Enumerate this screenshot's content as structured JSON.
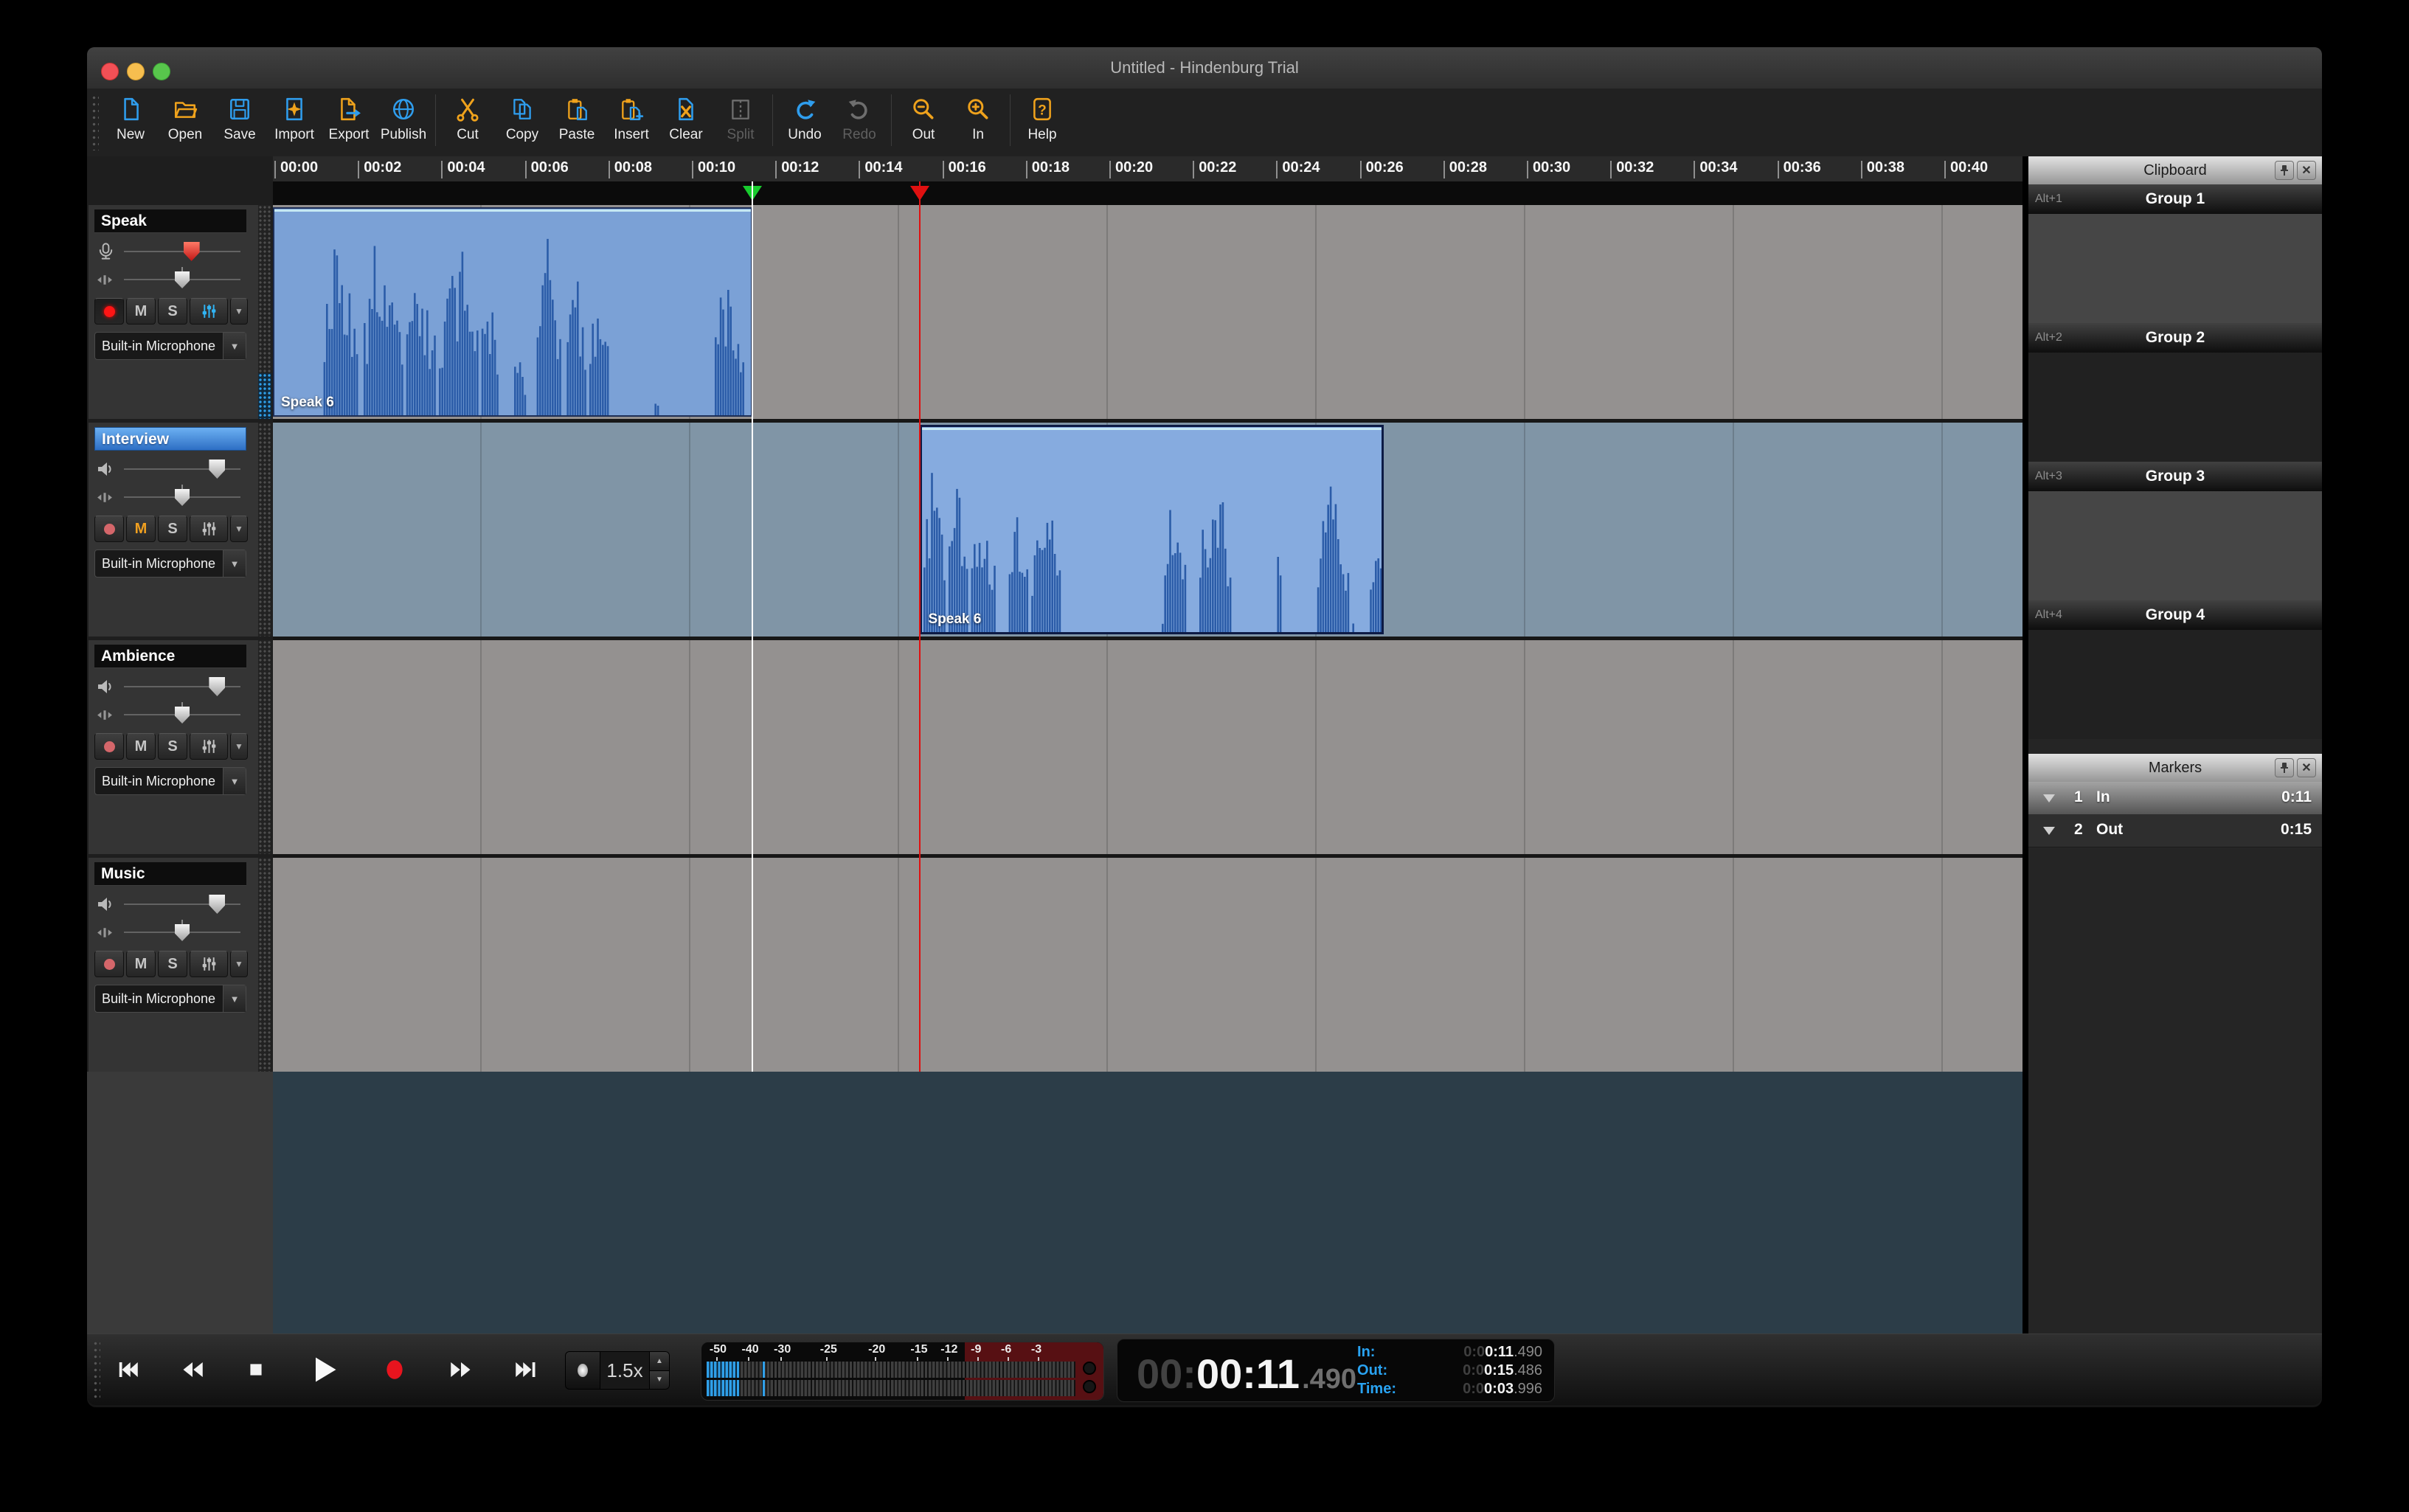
{
  "window": {
    "title": "Untitled - Hindenburg Trial"
  },
  "toolbar": {
    "items": [
      {
        "id": "new",
        "label": "New",
        "enabled": true
      },
      {
        "id": "open",
        "label": "Open",
        "enabled": true
      },
      {
        "id": "save",
        "label": "Save",
        "enabled": true
      },
      {
        "id": "import",
        "label": "Import",
        "enabled": true
      },
      {
        "id": "export",
        "label": "Export",
        "enabled": true
      },
      {
        "id": "publish",
        "label": "Publish",
        "enabled": true
      },
      {
        "id": "sep"
      },
      {
        "id": "cut",
        "label": "Cut",
        "enabled": true
      },
      {
        "id": "copy",
        "label": "Copy",
        "enabled": true
      },
      {
        "id": "paste",
        "label": "Paste",
        "enabled": true
      },
      {
        "id": "insert",
        "label": "Insert",
        "enabled": true
      },
      {
        "id": "clear",
        "label": "Clear",
        "enabled": true
      },
      {
        "id": "split",
        "label": "Split",
        "enabled": false
      },
      {
        "id": "sep"
      },
      {
        "id": "undo",
        "label": "Undo",
        "enabled": true
      },
      {
        "id": "redo",
        "label": "Redo",
        "enabled": false
      },
      {
        "id": "sep"
      },
      {
        "id": "out",
        "label": "Out",
        "enabled": true
      },
      {
        "id": "in",
        "label": "In",
        "enabled": true
      },
      {
        "id": "sep"
      },
      {
        "id": "help",
        "label": "Help",
        "enabled": true
      }
    ]
  },
  "ruler": {
    "labels": [
      "00:00",
      "00:02",
      "00:04",
      "00:06",
      "00:08",
      "00:10",
      "00:12",
      "00:14",
      "00:16",
      "00:18",
      "00:20",
      "00:22",
      "00:24",
      "00:26",
      "00:28",
      "00:30",
      "00:32",
      "00:34",
      "00:36",
      "00:38",
      "00:40"
    ]
  },
  "tracks": [
    {
      "name": "Speak",
      "selected": false,
      "armed": true,
      "muted": false,
      "eq_active": true,
      "volume": 0.58,
      "pan": 0.5,
      "device": "Built-in Microphone",
      "meter_signal": true
    },
    {
      "name": "Interview",
      "selected": true,
      "armed": false,
      "muted": true,
      "eq_active": false,
      "volume": 0.8,
      "pan": 0.5,
      "device": "Built-in Microphone",
      "meter_signal": false
    },
    {
      "name": "Ambience",
      "selected": false,
      "armed": false,
      "muted": false,
      "eq_active": false,
      "volume": 0.8,
      "pan": 0.5,
      "device": "Built-in Microphone",
      "meter_signal": false
    },
    {
      "name": "Music",
      "selected": false,
      "armed": false,
      "muted": false,
      "eq_active": false,
      "volume": 0.8,
      "pan": 0.5,
      "device": "Built-in Microphone",
      "meter_signal": false
    }
  ],
  "clips": [
    {
      "track": 0,
      "label": "Speak 6",
      "start_s": 0.0,
      "end_s": 11.49,
      "selected": false,
      "bursts": [
        [
          0.1,
          0.175,
          1.0
        ],
        [
          0.185,
          0.27,
          0.95
        ],
        [
          0.275,
          0.335,
          0.9
        ],
        [
          0.345,
          0.425,
          0.92
        ],
        [
          0.43,
          0.47,
          0.65
        ],
        [
          0.5,
          0.525,
          0.4
        ],
        [
          0.55,
          0.6,
          0.95
        ],
        [
          0.61,
          0.655,
          0.9
        ],
        [
          0.66,
          0.7,
          0.8
        ],
        [
          0.795,
          0.807,
          0.12
        ],
        [
          0.92,
          0.985,
          0.8
        ]
      ]
    },
    {
      "track": 1,
      "label": "Speak 6",
      "start_s": 15.486,
      "end_s": 26.6,
      "selected": true,
      "bursts": [
        [
          0.0,
          0.05,
          1.0
        ],
        [
          0.055,
          0.1,
          0.85
        ],
        [
          0.105,
          0.16,
          0.72
        ],
        [
          0.185,
          0.23,
          0.8
        ],
        [
          0.235,
          0.3,
          0.72
        ],
        [
          0.52,
          0.57,
          0.88
        ],
        [
          0.6,
          0.67,
          0.9
        ],
        [
          0.765,
          0.778,
          0.55
        ],
        [
          0.855,
          0.925,
          0.82
        ],
        [
          0.97,
          1.0,
          0.55
        ]
      ]
    }
  ],
  "timeline_markers": {
    "in_s": 11.49,
    "out_s": 15.486
  },
  "clipboard": {
    "title": "Clipboard",
    "groups": [
      {
        "shortcut": "Alt+1",
        "label": "Group 1"
      },
      {
        "shortcut": "Alt+2",
        "label": "Group 2"
      },
      {
        "shortcut": "Alt+3",
        "label": "Group 3"
      },
      {
        "shortcut": "Alt+4",
        "label": "Group 4"
      }
    ]
  },
  "markers_panel": {
    "title": "Markers",
    "rows": [
      {
        "num": "1",
        "name": "In",
        "time": "0:11"
      },
      {
        "num": "2",
        "name": "Out",
        "time": "0:15"
      }
    ]
  },
  "transport": {
    "buttons": [
      "skip-start",
      "rewind",
      "stop",
      "play",
      "record",
      "fast-forward",
      "skip-end"
    ],
    "speed": "1.5x",
    "meter": {
      "scale": [
        [
          "-50",
          2
        ],
        [
          "-40",
          10
        ],
        [
          "-30",
          18
        ],
        [
          "-25",
          29.5
        ],
        [
          "-20",
          41.5
        ],
        [
          "-15",
          52
        ],
        [
          "-12",
          59.5
        ],
        [
          "-9",
          67
        ],
        [
          "-6",
          74.5
        ],
        [
          "-3",
          82
        ]
      ],
      "lit_frac": 0.09,
      "isolated_frac": 0.152
    },
    "time": {
      "dim_prefix": "00:",
      "main": "00:11",
      "decimals": ".490"
    },
    "info": [
      {
        "label": "In:",
        "prefix": "0:0",
        "value": "0:11",
        "decimals": ".490"
      },
      {
        "label": "Out:",
        "prefix": "0:0",
        "value": "0:15",
        "decimals": ".486"
      },
      {
        "label": "Time:",
        "prefix": "0:0",
        "value": "0:03",
        "decimals": ".996"
      }
    ]
  },
  "colors": {
    "accent_blue": "#2f9ded",
    "accent_orange": "#efa21c",
    "clip_bg": "#7ba1d6",
    "clip_bg_selected": "#86abdf",
    "waveform": "#2b5ca8",
    "row_gray": "#949190",
    "row_blue": "#8095a6",
    "playhead": "#ffffff",
    "out_marker": "#e01010",
    "in_marker": "#18cc2e"
  }
}
